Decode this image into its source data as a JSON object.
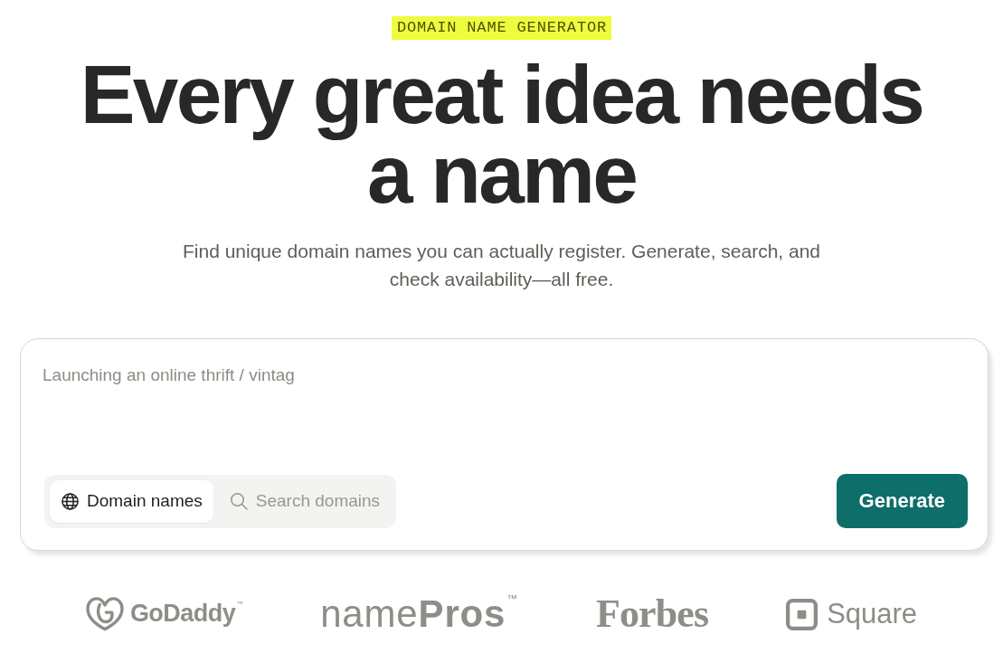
{
  "eyebrow": "DOMAIN NAME GENERATOR",
  "headline": "Every great idea needs a name",
  "subtitle": "Find unique domain names you can actually register. Generate, search, and check availability—all free.",
  "prompt": {
    "placeholder": "Launching an online thrift / vintag"
  },
  "modes": [
    {
      "label": "Domain names",
      "selected": true
    },
    {
      "label": "Search domains",
      "selected": false
    }
  ],
  "generate_button": {
    "label": "Generate"
  },
  "logos": [
    {
      "kind": "swirl",
      "text": "GoDaddy$^{™}$"
    },
    {
      "kind": "sans",
      "text": "name**Pros**$^{™}$"
    },
    {
      "kind": "serif",
      "text": "Forbes"
    },
    {
      "kind": "square",
      "text": "Square"
    }
  ]
}
